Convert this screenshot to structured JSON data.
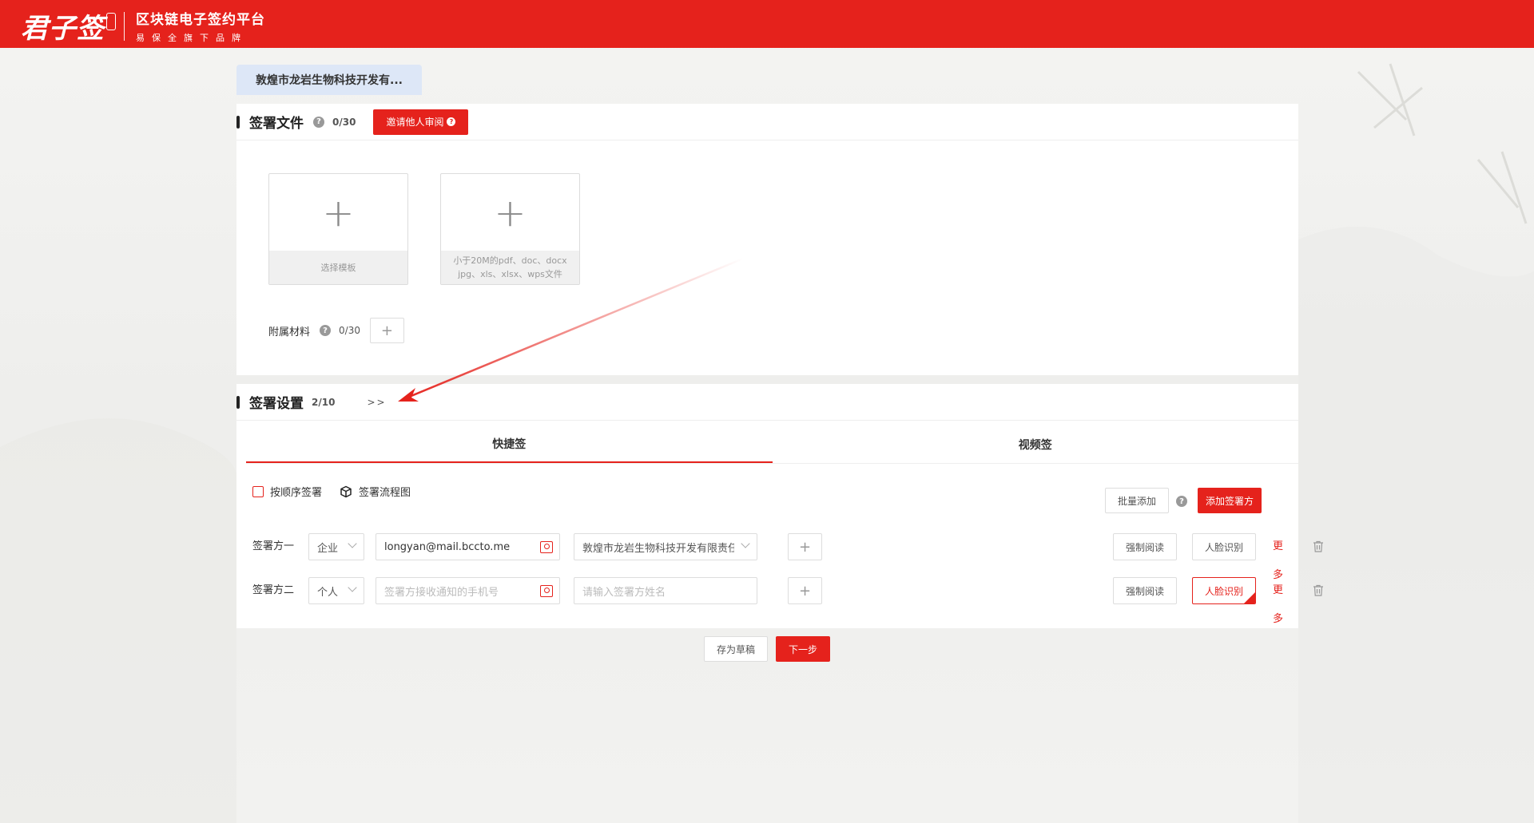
{
  "header": {
    "logo_text": "君子签",
    "platform_title": "区块链电子签约平台",
    "platform_subtitle": "易保全旗下品牌"
  },
  "doc_tab": {
    "label": "敦煌市龙岩生物科技开发有..."
  },
  "files_section": {
    "title": "签署文件",
    "count": "0/30",
    "invite_button": "邀请他人审阅",
    "template_card_label": "选择模板",
    "upload_card_label_line1": "小于20M的pdf、doc、docx",
    "upload_card_label_line2": "jpg、xls、xlsx、wps文件",
    "attach_label": "附属材料",
    "attach_count": "0/30",
    "plus": "+"
  },
  "settings_section": {
    "title": "签署设置",
    "count": "2/10",
    "expand": ">>",
    "tabs": [
      {
        "label": "快捷签",
        "active": true
      },
      {
        "label": "视频签",
        "active": false
      }
    ],
    "sequential_label": "按顺序签署",
    "flowchart_label": "签署流程图",
    "batch_add_button": "批量添加",
    "add_party_button": "添加签署方",
    "parties": [
      {
        "label": "签署方一",
        "type": "企业",
        "contact_value": "longyan@mail.bccto.me",
        "contact_placeholder": "",
        "name_value": "敦煌市龙岩生物科技开发有限责任",
        "name_placeholder": "",
        "force_read": "强制阅读",
        "face_id": "人脸识别",
        "more": "更多"
      },
      {
        "label": "签署方二",
        "type": "个人",
        "contact_value": "",
        "contact_placeholder": "签署方接收通知的手机号",
        "name_value": "",
        "name_placeholder": "请输入签署方姓名",
        "force_read": "强制阅读",
        "face_id": "人脸识别",
        "more": "更多"
      }
    ]
  },
  "footer": {
    "draft_button": "存为草稿",
    "next_button": "下一步"
  },
  "colors": {
    "brand_red": "#e5221c",
    "tab_bg": "#dde7f7"
  }
}
